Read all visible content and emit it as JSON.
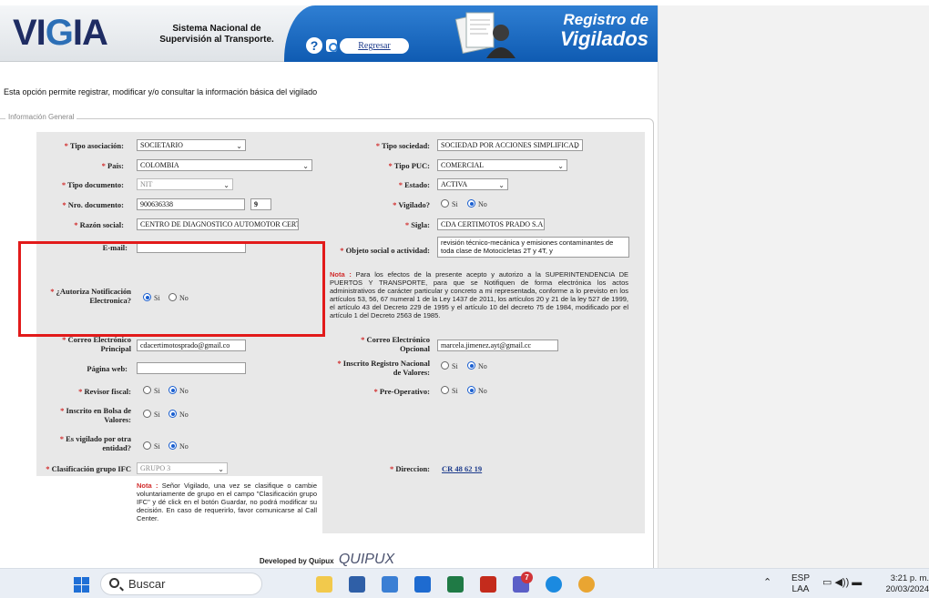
{
  "header": {
    "logo_text": "VIGIA",
    "subtitle": "Sistema Nacional de Supervisión al Transporte.",
    "back_label": "Regresar",
    "title_line1": "Registro de",
    "title_line2": "Vigilados"
  },
  "intro": "Esta opción permite registrar, modificar y/o consultar la información básica del vigilado",
  "section_legend": "Información General",
  "left": {
    "tipo_asociacion": {
      "label": "Tipo asociación:",
      "value": "SOCIETARIO"
    },
    "pais": {
      "label": "País:",
      "value": "COLOMBIA"
    },
    "tipo_documento": {
      "label": "Tipo documento:",
      "value": "NIT"
    },
    "nro_documento": {
      "label": "Nro. documento:",
      "value": "900636338",
      "dv": "9"
    },
    "razon_social": {
      "label": "Razón social:",
      "value": "CENTRO DE DIAGNOSTICO AUTOMOTOR CERT"
    },
    "email": {
      "label": "E-mail:",
      "value": ""
    },
    "autoriza": {
      "label1": "¿Autoriza Notificación",
      "label2": "Electronica?",
      "si": "Si",
      "no": "No",
      "selected": "Si"
    },
    "correo_principal": {
      "label1": "Correo Electrónico",
      "label2": "Principal",
      "value": "cdacertimotosprado@gmail.co"
    },
    "pagina_web": {
      "label": "Página web:",
      "value": ""
    },
    "revisor_fiscal": {
      "label": "Revisor fiscal:",
      "si": "Si",
      "no": "No",
      "selected": "No"
    },
    "bolsa": {
      "label1": "Inscrito en Bolsa de",
      "label2": "Valores:",
      "si": "Si",
      "no": "No",
      "selected": "No"
    },
    "vigilado_otra": {
      "label1": "Es vigilado por otra",
      "label2": "entidad?",
      "si": "Si",
      "no": "No",
      "selected": "No"
    },
    "clasificacion": {
      "label": "Clasificación grupo IFC",
      "value": "GRUPO 3"
    },
    "nota_title": "Nota :",
    "nota_text": "Señor Vigilado, una vez se clasifique o cambie voluntariamente de grupo en el campo \"Clasificación grupo IFC\" y dé click en el botón Guardar, no podrá modificar su decisión. En caso de requerirlo, favor comunicarse al Call Center."
  },
  "right": {
    "tipo_sociedad": {
      "label": "Tipo sociedad:",
      "value": "SOCIEDAD POR ACCIONES SIMPLIFICAD"
    },
    "tipo_puc": {
      "label": "Tipo PUC:",
      "value": "COMERCIAL"
    },
    "estado": {
      "label": "Estado:",
      "value": "ACTIVA"
    },
    "vigilado": {
      "label": "Vigilado?",
      "si": "Si",
      "no": "No",
      "selected": "No"
    },
    "sigla": {
      "label": "Sigla:",
      "value": "CDA CERTIMOTOS PRADO S.A"
    },
    "objeto": {
      "label": "Objeto social o actividad:",
      "value": "revisión técnico-mecánica y emisiones contaminantes de toda clase de Motocicletas 2T y 4T, y"
    },
    "nota_title": "Nota :",
    "nota_text": "Para los efectos de la presente acepto y autorizo a la SUPERINTENDENCIA DE PUERTOS Y TRANSPORTE, para que se Notifiquen de forma electrónica los actos administrativos de carácter particular y concreto a mi representada, conforme a lo previsto en los artículos 53, 56, 67 numeral 1 de la Ley 1437 de 2011, los artículos 20 y 21 de la ley 527 de 1999, el artículo 43 del Decreto 229 de 1995 y el artículo 10 del decreto 75 de 1984, modificado por el artículo 1 del Decreto 2563 de 1985.",
    "correo_opcional": {
      "label1": "Correo Electrónico",
      "label2": "Opcional",
      "value": "marcela.jimenez.ayt@gmail.cc"
    },
    "registro_nacional": {
      "label1": "Inscrito Registro Nacional",
      "label2": "de Valores:",
      "si": "Si",
      "no": "No",
      "selected": "No"
    },
    "pre_operativo": {
      "label": "Pre-Operativo:",
      "si": "Si",
      "no": "No",
      "selected": "No"
    },
    "direccion": {
      "label": "Direccion:",
      "value": "CR 48 62 19"
    }
  },
  "footer": {
    "developed": "Developed by Quipux",
    "brand": "QUIPUX"
  },
  "taskbar": {
    "search": "Buscar",
    "badge": "7",
    "lang1": "ESP",
    "lang2": "LAA",
    "time": "3:21 p. m.",
    "date": "20/03/2024"
  }
}
